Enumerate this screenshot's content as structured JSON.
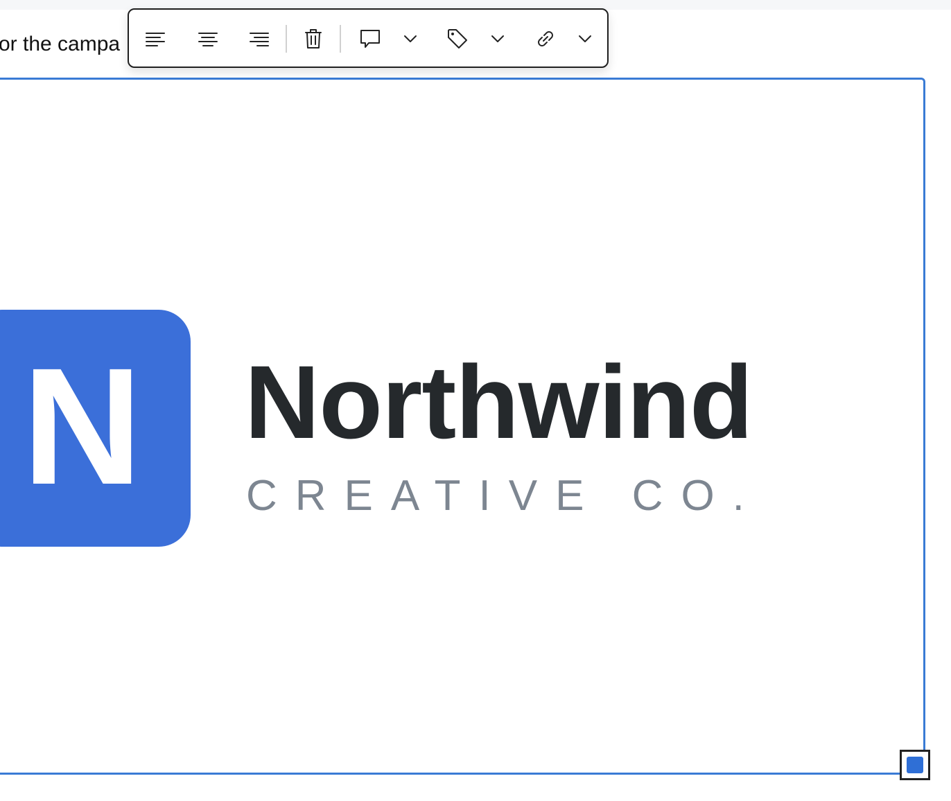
{
  "editor": {
    "body_text": "or the campa"
  },
  "toolbar": {
    "buttons": {
      "align_left": "align-left-icon",
      "align_center": "align-center-icon",
      "align_right": "align-right-icon",
      "delete": "trash-icon",
      "comment": "comment-icon",
      "tag": "tag-icon",
      "link": "link-icon"
    }
  },
  "image": {
    "logo_letter": "N",
    "logo_name": "Northwind",
    "logo_subtitle": "CREATIVE CO."
  },
  "colors": {
    "selection": "#3a7bd5",
    "brand_blue": "#3b6fd9",
    "logo_text": "#25292c",
    "logo_subtext": "#7d8691"
  }
}
